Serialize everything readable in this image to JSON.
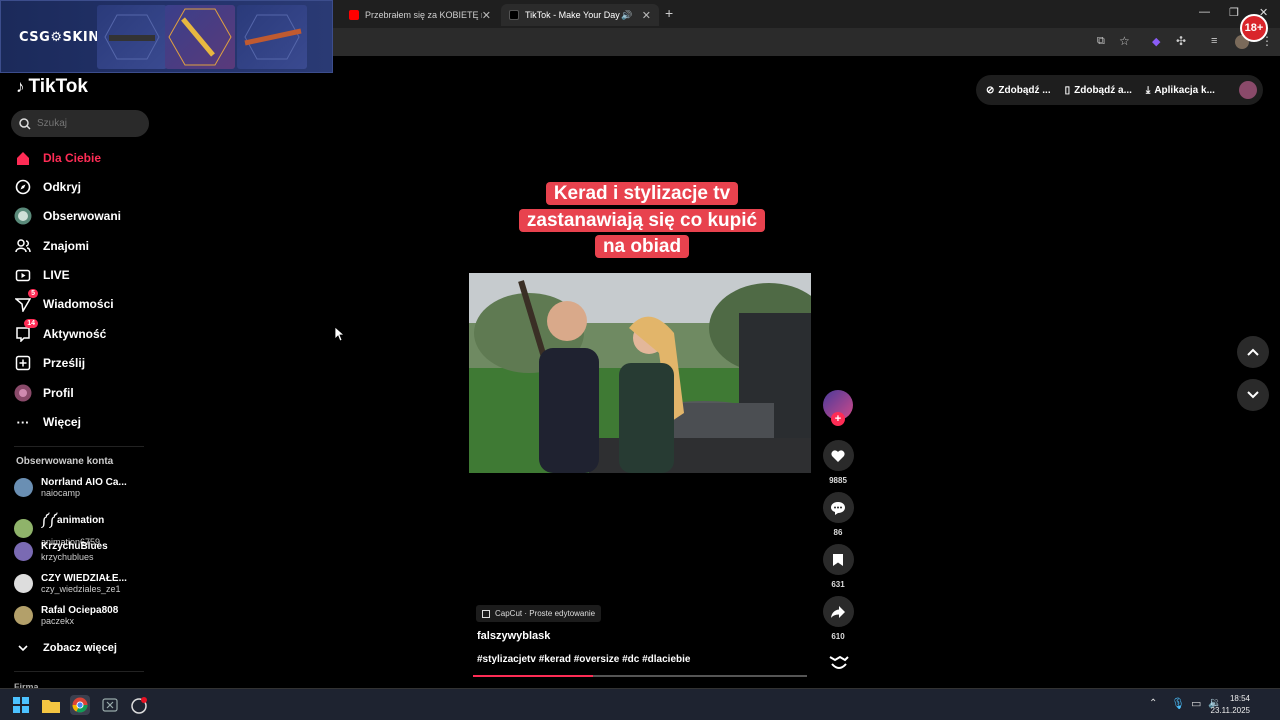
{
  "browser": {
    "tabs": [
      {
        "title": "Przebrałem się za KOBIETĘ na S",
        "active": false,
        "favicon_color": "#ff0000"
      },
      {
        "title": "TikTok - Make Your Day",
        "active": true,
        "favicon_color": "#000000"
      }
    ],
    "new_tab": "+"
  },
  "ad": {
    "brand": "CSG⚙SKINS",
    "badge": "18+"
  },
  "tiktok": {
    "logo": "TikTok",
    "search_placeholder": "Szukaj",
    "nav": [
      {
        "label": "Dla Ciebie",
        "icon": "home-icon",
        "active": true
      },
      {
        "label": "Odkryj",
        "icon": "compass-icon"
      },
      {
        "label": "Obserwowani",
        "icon": "following-avatar-icon"
      },
      {
        "label": "Znajomi",
        "icon": "friends-icon"
      },
      {
        "label": "LIVE",
        "icon": "live-tv-icon"
      },
      {
        "label": "Wiadomości",
        "icon": "send-icon",
        "badge": "5"
      },
      {
        "label": "Aktywność",
        "icon": "activity-icon",
        "badge": "14"
      },
      {
        "label": "Prześlij",
        "icon": "upload-icon"
      },
      {
        "label": "Profil",
        "icon": "profile-avatar-icon"
      },
      {
        "label": "Więcej",
        "icon": "more-dots-icon"
      }
    ],
    "followed_title": "Obserwowane konta",
    "accounts": [
      {
        "name": "Norrland AIO Ca...",
        "handle": "naiocamp",
        "color": "#6a8fb3"
      },
      {
        "name": "༼༼animation",
        "handle": "animation6759",
        "color": "#8fb36a"
      },
      {
        "name": "KrzychuBlues",
        "handle": "krzychublues",
        "color": "#7a6ab3"
      },
      {
        "name": "CZY WIEDZIAŁE...",
        "handle": "czy_wiedziales_ze1",
        "color": "#dddddd"
      },
      {
        "name": "Rafal Ociepa808",
        "handle": "paczekx",
        "color": "#b3a06a"
      }
    ],
    "see_more": "Zobacz więcej",
    "footer_cut": "Firma",
    "top_buttons": [
      "Zdobądź ...",
      "Zdobądź a...",
      "Aplikacja k..."
    ],
    "video": {
      "caption": "Kerad i stylizacje tv zastanawiają się co kupić na obiad",
      "capcut": "CapCut · Proste edytowanie",
      "author": "falszywyblask",
      "tags": "#stylizacjetv #kerad #oversize #dc #dlaciebie",
      "progress": 0.36
    },
    "actions": {
      "likes": "9885",
      "comments": "86",
      "saves": "631",
      "shares": "610"
    }
  },
  "taskbar": {
    "time": "18:54",
    "date": "23.11.2025"
  }
}
